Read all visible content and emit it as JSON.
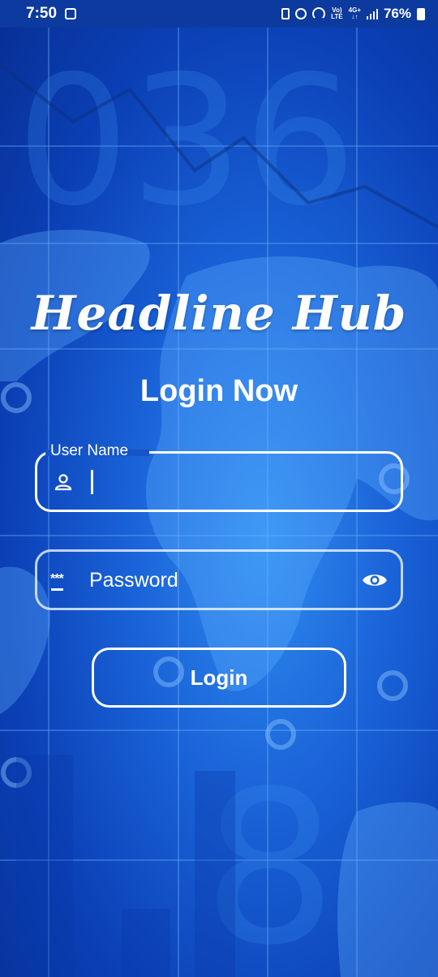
{
  "status_bar": {
    "time": "7:50",
    "network_top": "Vo)",
    "network_bottom": "LTE",
    "signal_top": "4G+",
    "battery": "76%"
  },
  "app": {
    "title": "Headline Hub",
    "subtitle": "Login Now"
  },
  "form": {
    "username_label": "User Name",
    "username_value": "",
    "password_placeholder": "Password",
    "login_label": "Login"
  },
  "icons": {
    "username": "person-icon",
    "password": "password-dots-icon",
    "visibility": "eye-icon"
  },
  "colors": {
    "background": "#1a63d8",
    "accent": "#ffffff"
  }
}
